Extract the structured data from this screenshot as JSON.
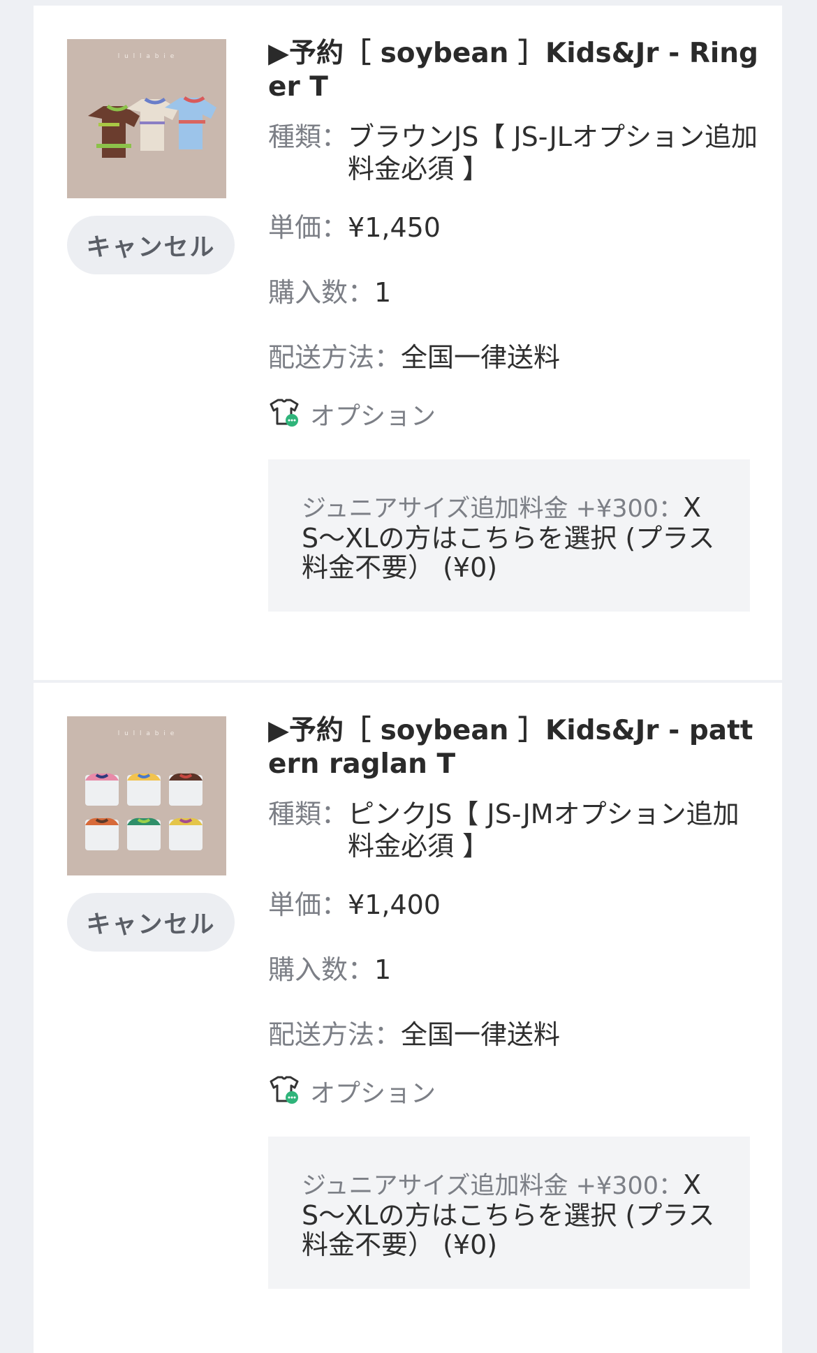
{
  "items": [
    {
      "title": "▶予約［ soybean ］Kids&Jr - Ringer T",
      "thumb_label": "l u l l a b i e",
      "cancel_label": "キャンセル",
      "kind_label": "種類：",
      "kind_value": "ブラウンJS【 JS-JLオプション追加料金必須 】",
      "price_label": "単価：",
      "price_value": "¥1,450",
      "qty_label": "購入数：",
      "qty_value": "1",
      "ship_label": "配送方法：",
      "ship_value": "全国一律送料",
      "option_label": "オプション",
      "option_name": "ジュニアサイズ追加料金 +¥300：",
      "option_value": "XS〜XLの方はこちらを選択 (プラス料金不要） (¥0)"
    },
    {
      "title": "▶予約［ soybean ］Kids&Jr - pattern raglan T",
      "thumb_label": "l u l l a b i e",
      "cancel_label": "キャンセル",
      "kind_label": "種類：",
      "kind_value": "ピンクJS【 JS-JMオプション追加料金必須 】",
      "price_label": "単価：",
      "price_value": "¥1,400",
      "qty_label": "購入数：",
      "qty_value": "1",
      "ship_label": "配送方法：",
      "ship_value": "全国一律送料",
      "option_label": "オプション",
      "option_name": "ジュニアサイズ追加料金 +¥300：",
      "option_value": "XS〜XLの方はこちらを選択 (プラス料金不要） (¥0)"
    }
  ],
  "colors": {
    "badge_green": "#2fb47a",
    "background": "#eef0f4",
    "card": "#ffffff"
  }
}
